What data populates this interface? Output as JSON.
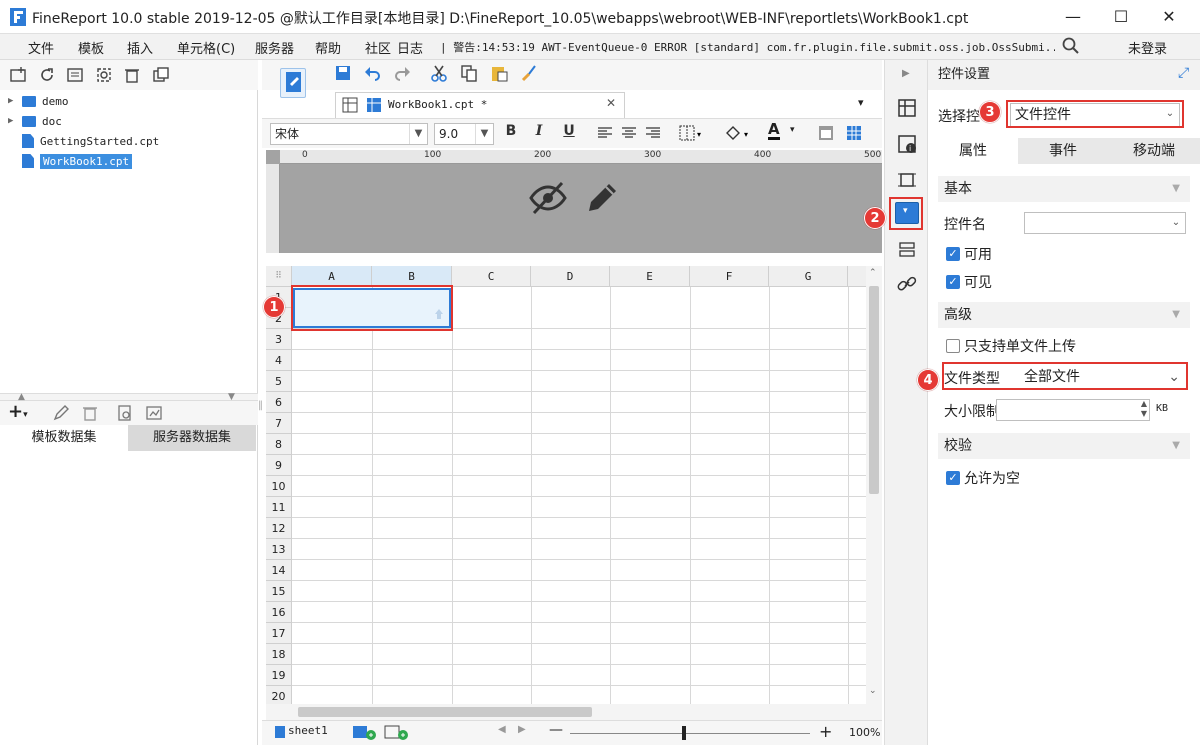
{
  "window": {
    "title": "FineReport 10.0 stable 2019-12-05 @默认工作目录[本地目录]    D:\\FineReport_10.05\\webapps\\webroot\\WEB-INF\\reportlets\\WorkBook1.cpt",
    "minimize": "—",
    "maximize": "☐",
    "close": "✕"
  },
  "menu": {
    "items": [
      "文件",
      "模板",
      "插入",
      "单元格(C)",
      "服务器",
      "帮助",
      "社区",
      "日志"
    ],
    "notice": "| 警告:14:53:19 AWT-EventQueue-0 ERROR [standard] com.fr.plugin.file.submit.oss.job.OssSubmi...",
    "login": "未登录"
  },
  "tree": {
    "items": [
      {
        "label": "demo",
        "type": "folder"
      },
      {
        "label": "doc",
        "type": "folder"
      },
      {
        "label": "GettingStarted.cpt",
        "type": "file"
      },
      {
        "label": "WorkBook1.cpt",
        "type": "file",
        "selected": true
      }
    ]
  },
  "datasets": {
    "tab1": "模板数据集",
    "tab2": "服务器数据集"
  },
  "editor": {
    "tab_label": "WorkBook1.cpt *",
    "font_name": "宋体",
    "font_size": "9.0",
    "bold": "B",
    "italic": "I",
    "underline": "U",
    "font_color": "A"
  },
  "ruler": {
    "ticks": [
      "0",
      "100",
      "200",
      "300",
      "400",
      "500"
    ]
  },
  "grid": {
    "columns": [
      "A",
      "B",
      "C",
      "D",
      "E",
      "F",
      "G"
    ],
    "rows": [
      "1",
      "2",
      "3",
      "4",
      "5",
      "6",
      "7",
      "8",
      "9",
      "10",
      "11",
      "12",
      "13",
      "14",
      "15",
      "16",
      "17",
      "18",
      "19",
      "20"
    ]
  },
  "sheet": {
    "name": "sheet1",
    "zoom": "100%",
    "zoom_minus": "—",
    "zoom_plus": "+"
  },
  "right_panel": {
    "title": "控件设置",
    "select_label": "选择控",
    "select_value": "文件控件",
    "tabs": [
      "属性",
      "事件",
      "移动端"
    ],
    "section_basic": "基本",
    "widget_name_label": "控件名",
    "widget_name_value": "",
    "enabled_label": "可用",
    "visible_label": "可见",
    "section_advanced": "高级",
    "single_file_label": "只支持单文件上传",
    "file_type_label": "文件类型",
    "file_type_value": "全部文件",
    "size_limit_label": "大小限制",
    "size_unit": "KB",
    "section_validate": "校验",
    "allow_empty_label": "允许为空"
  },
  "badges": [
    "1",
    "2",
    "3",
    "4"
  ],
  "colors": {
    "accent": "#2d7bd6",
    "highlight": "#e53935",
    "selected_cell": "#e8f3fc"
  }
}
